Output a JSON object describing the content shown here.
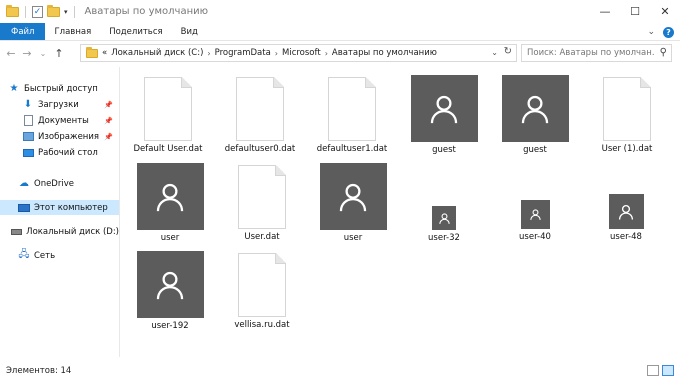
{
  "window": {
    "title": "Аватары по умолчанию",
    "minimize": "—",
    "maximize": "☐",
    "close": "✕"
  },
  "quick_access_toolbar": {
    "check_glyph": "✓",
    "dropdown_glyph": "▾"
  },
  "ribbon": {
    "tabs": [
      "Файл",
      "Главная",
      "Поделиться",
      "Вид"
    ],
    "expand_glyph": "⌄",
    "help_glyph": "?"
  },
  "navigation": {
    "back": "←",
    "forward": "→",
    "recent": "⌄",
    "up": "↑",
    "breadcrumb_overflow": "«",
    "breadcrumb": [
      "Локальный диск (C:)",
      "ProgramData",
      "Microsoft",
      "Аватары по умолчанию"
    ],
    "separator": "›",
    "address_dropdown": "⌄",
    "refresh": "↻",
    "search_placeholder": "Поиск: Аватары по умолчан...",
    "search_icon": "⚲"
  },
  "nav_pane": {
    "items": [
      {
        "label": "Быстрый доступ",
        "icon": "star-icon",
        "pinned": false,
        "selected": false
      },
      {
        "label": "Загрузки",
        "icon": "download-icon",
        "pinned": true,
        "selected": false
      },
      {
        "label": "Документы",
        "icon": "documents-icon",
        "pinned": true,
        "selected": false
      },
      {
        "label": "Изображения",
        "icon": "pictures-icon",
        "pinned": true,
        "selected": false
      },
      {
        "label": "Рабочий стол",
        "icon": "desktop-icon",
        "pinned": false,
        "selected": false
      },
      {
        "label": "OneDrive",
        "icon": "cloud-icon",
        "pinned": false,
        "selected": false
      },
      {
        "label": "Этот компьютер",
        "icon": "computer-icon",
        "pinned": false,
        "selected": true
      },
      {
        "label": "Локальный диск (D:)",
        "icon": "drive-icon",
        "pinned": false,
        "selected": false
      },
      {
        "label": "Сеть",
        "icon": "network-icon",
        "pinned": false,
        "selected": false
      }
    ],
    "pin_glyph": "📌"
  },
  "files": [
    {
      "name": "Default User.dat",
      "kind": "document"
    },
    {
      "name": "defaultuser0.dat",
      "kind": "document"
    },
    {
      "name": "defaultuser1.dat",
      "kind": "document"
    },
    {
      "name": "guest",
      "kind": "avatar-large"
    },
    {
      "name": "guest",
      "kind": "avatar-large"
    },
    {
      "name": "User (1).dat",
      "kind": "document"
    },
    {
      "name": "user",
      "kind": "avatar-large"
    },
    {
      "name": "User.dat",
      "kind": "document"
    },
    {
      "name": "user",
      "kind": "avatar-large"
    },
    {
      "name": "user-32",
      "kind": "avatar-small"
    },
    {
      "name": "user-40",
      "kind": "avatar-small"
    },
    {
      "name": "user-48",
      "kind": "avatar-medium"
    },
    {
      "name": "user-192",
      "kind": "avatar-large"
    },
    {
      "name": "vellisa.ru.dat",
      "kind": "document"
    }
  ],
  "status_bar": {
    "item_count": "Элементов: 14"
  },
  "colors": {
    "accent": "#1979ca",
    "avatar_bg": "#5c5c5c",
    "selection": "#cce8ff"
  }
}
